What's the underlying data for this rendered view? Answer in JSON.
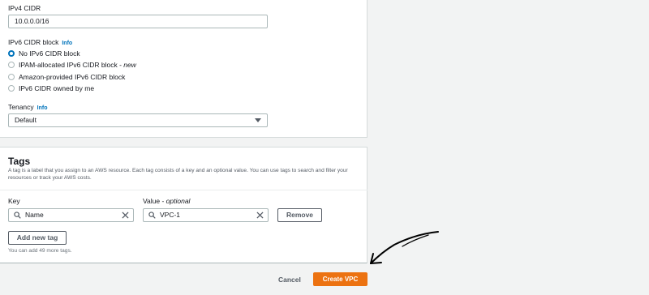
{
  "vpc_settings": {
    "ipv4_label": "IPv4 CIDR",
    "ipv4_value": "10.0.0.0/16",
    "ipv6_label": "IPv6 CIDR block",
    "info": "Info",
    "ipv6_options": [
      {
        "label": "No IPv6 CIDR block",
        "selected": true
      },
      {
        "label": "IPAM-allocated IPv6 CIDR block - ",
        "suffix": "new",
        "selected": false
      },
      {
        "label": "Amazon-provided IPv6 CIDR block",
        "selected": false
      },
      {
        "label": "IPv6 CIDR owned by me",
        "selected": false
      }
    ],
    "tenancy_label": "Tenancy",
    "tenancy_value": "Default"
  },
  "tags": {
    "title": "Tags",
    "description": "A tag is a label that you assign to an AWS resource. Each tag consists of a key and an optional value. You can use tags to search and filter your resources or track your AWS costs.",
    "key_header": "Key",
    "value_header": "Value - ",
    "value_header_suffix": "optional",
    "rows": [
      {
        "key": "Name",
        "value": "VPC-1"
      }
    ],
    "remove_label": "Remove",
    "add_label": "Add new tag",
    "remaining_note": "You can add 49 more tags."
  },
  "footer": {
    "cancel_label": "Cancel",
    "create_label": "Create VPC"
  },
  "colors": {
    "primary_button": "#ec7211",
    "link": "#0073bb",
    "annotation_arrow": "#000000"
  }
}
